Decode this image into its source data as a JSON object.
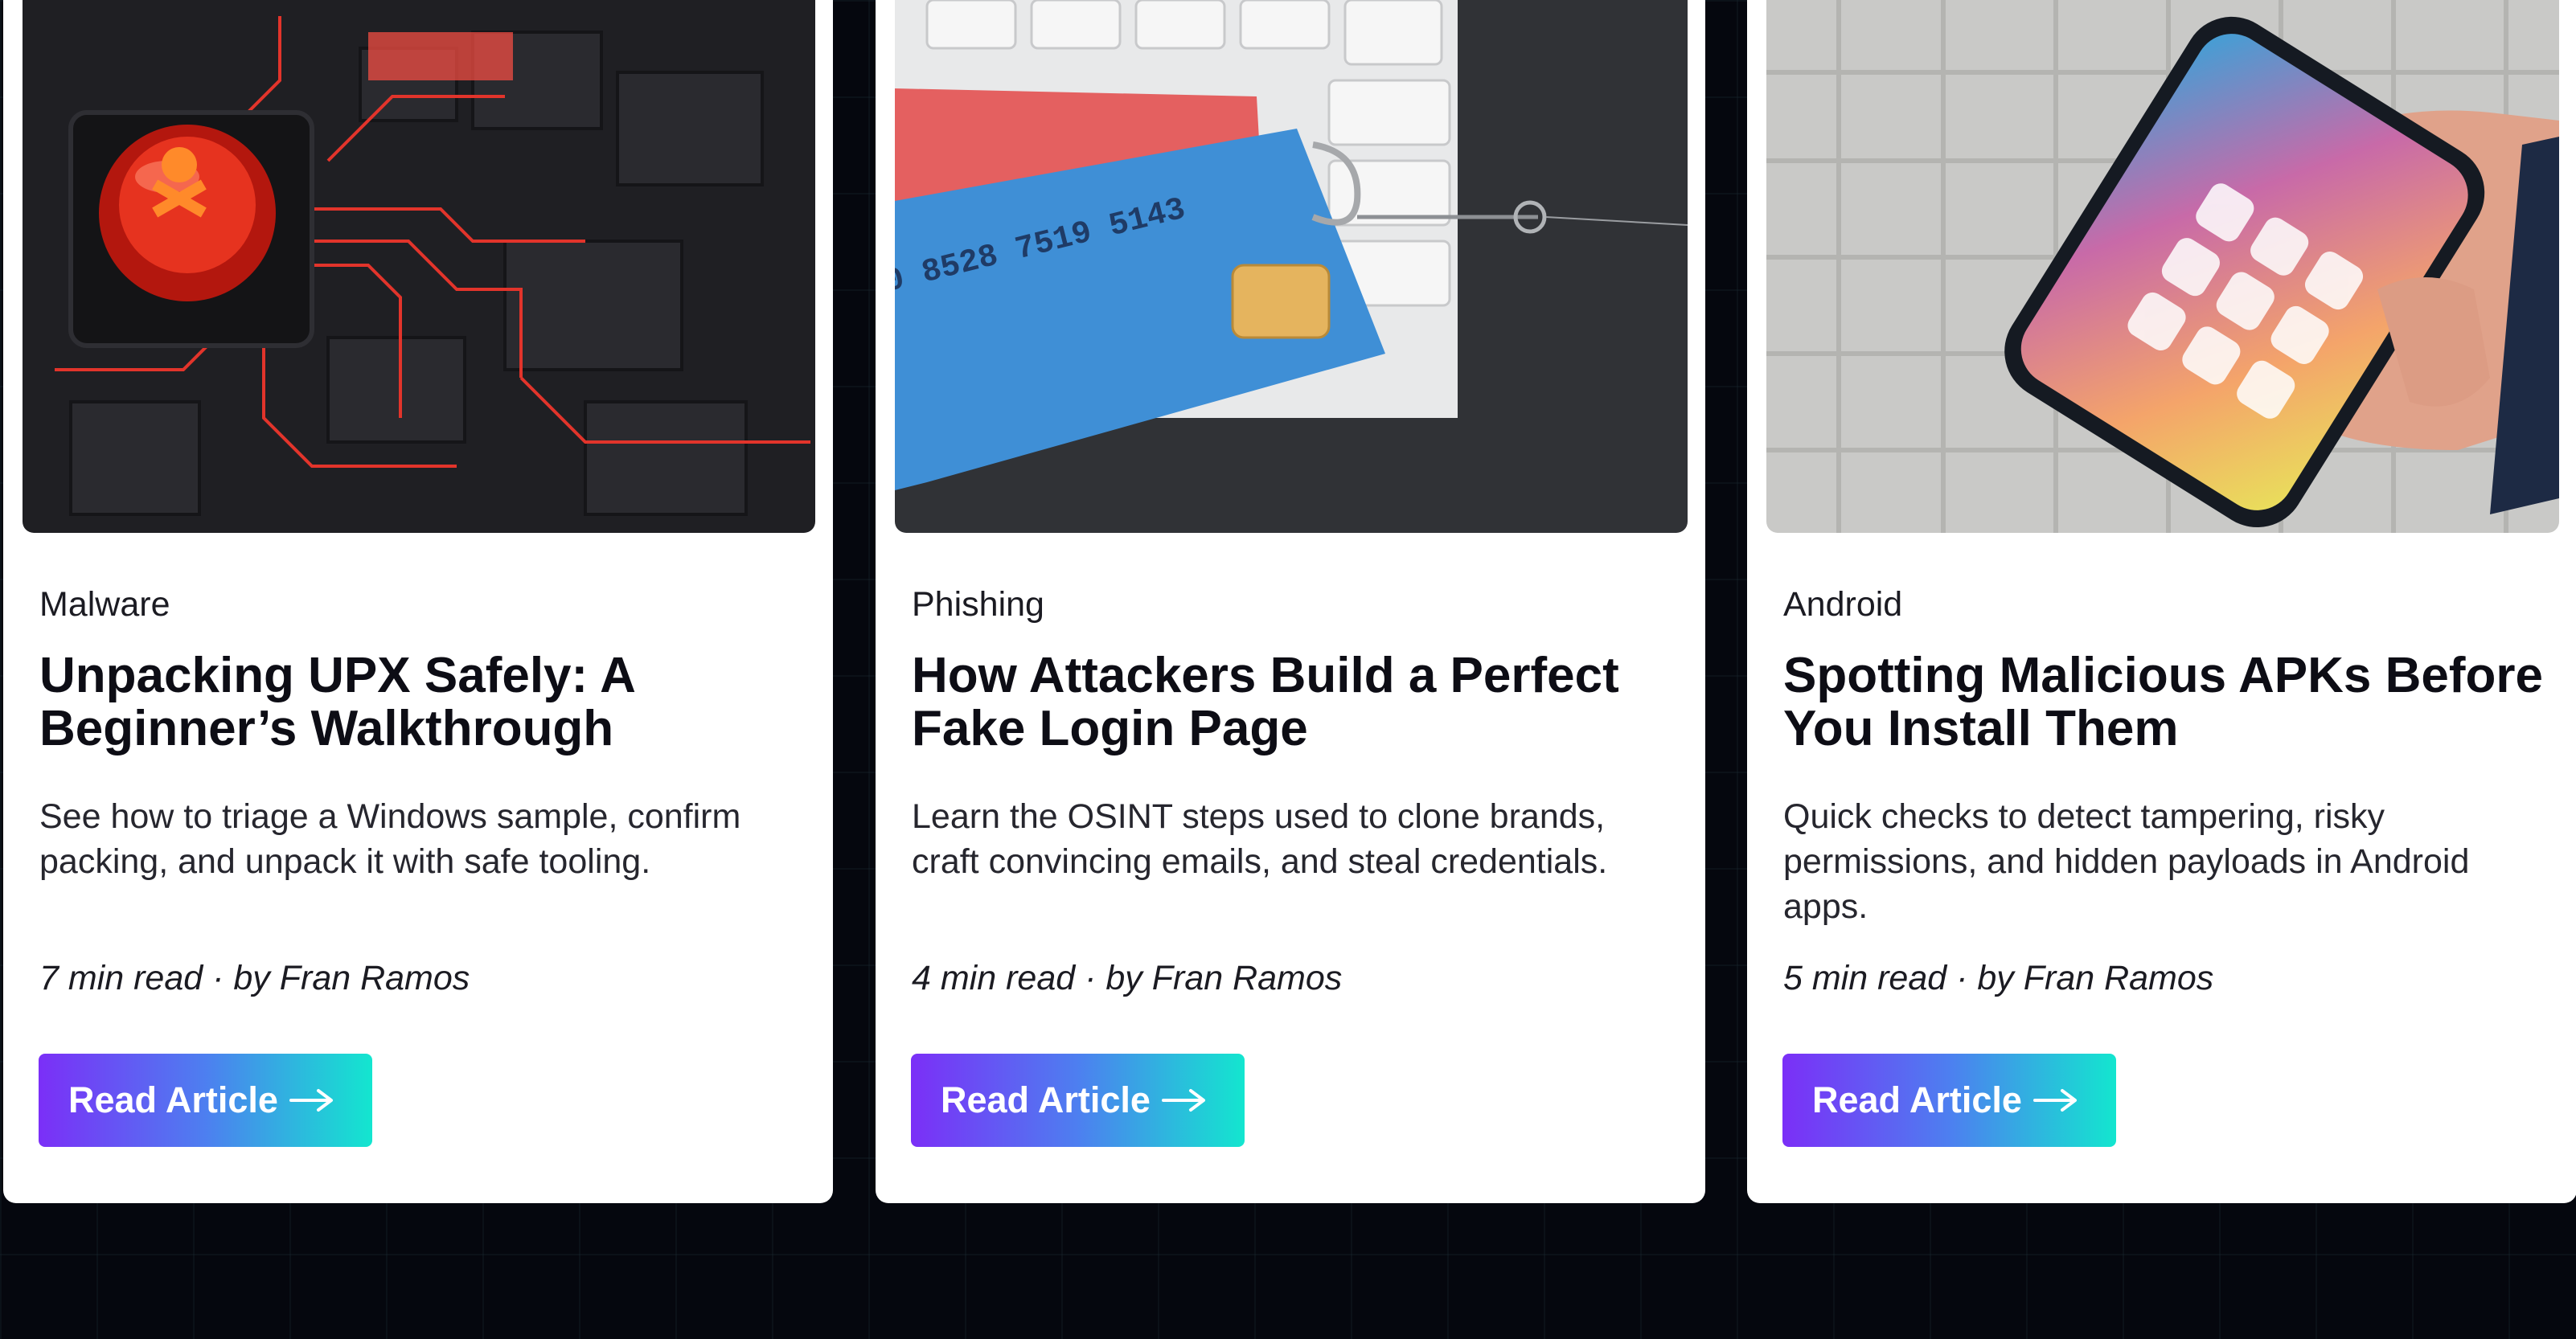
{
  "articles": [
    {
      "category": "Malware",
      "title": "Unpacking UPX Safely: A Beginner’s Walkthrough",
      "description": "See how to triage a Windows sample, confirm packing, and unpack it with safe tooling.",
      "meta": "7 min read · by Fran Ramos",
      "button_label": "Read Article",
      "image_icon": "malware-chip-image"
    },
    {
      "category": "Phishing",
      "title": "How Attackers Build a Perfect Fake Login Page",
      "description": "Learn the OSINT steps used to clone brands, craft convincing emails, and steal credentials.",
      "meta": "4 min read · by Fran Ramos",
      "button_label": "Read Article",
      "image_icon": "phishing-card-hook-image"
    },
    {
      "category": "Android",
      "title": "Spotting Malicious APKs Before You Install Them",
      "description": "Quick checks to detect tampering, risky permissions, and hidden payloads in Android apps.",
      "meta": "5 min read · by Fran Ramos",
      "button_label": "Read Article",
      "image_icon": "android-phone-image"
    }
  ],
  "colors": {
    "background": "#05070e",
    "card": "#ffffff",
    "button_gradient_start": "#7b2ff7",
    "button_gradient_end": "#13e6cf"
  }
}
